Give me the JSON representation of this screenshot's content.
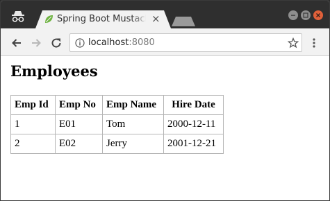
{
  "browser": {
    "tab_title": "Spring Boot Mustache",
    "tab_close": "×",
    "url_host": "localhost",
    "url_port": ":8080"
  },
  "page": {
    "title": "Employees",
    "table": {
      "headers": [
        "Emp Id",
        "Emp No",
        "Emp Name",
        "Hire Date"
      ],
      "rows": [
        [
          "1",
          "E01",
          "Tom",
          "2000-12-11"
        ],
        [
          "2",
          "E02",
          "Jerry",
          "2001-12-21"
        ]
      ]
    }
  }
}
